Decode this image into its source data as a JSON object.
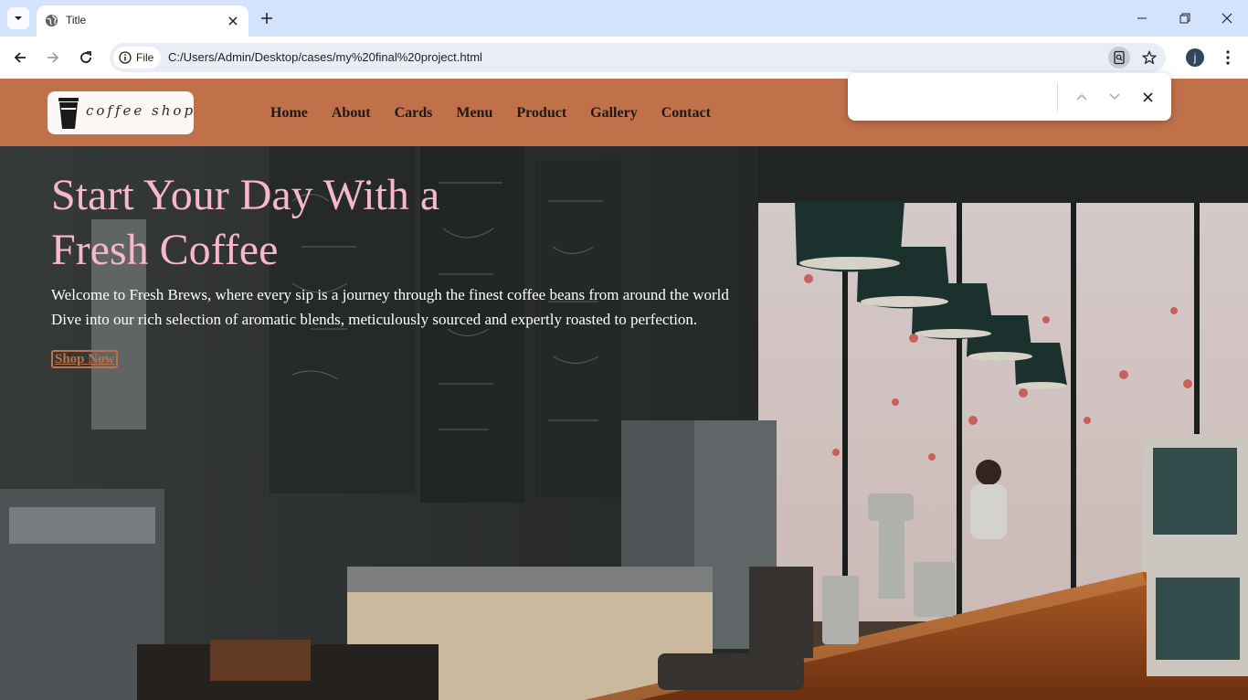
{
  "browser": {
    "tab_title": "Title",
    "address_chip": "File",
    "url": "C:/Users/Admin/Desktop/cases/my%20final%20project.html",
    "profile_initial": "j"
  },
  "site": {
    "logo_text": "coffee shop",
    "nav": [
      "Home",
      "About",
      "Cards",
      "Menu",
      "Product",
      "Gallery",
      "Contact"
    ],
    "accent_color": "#c0714a",
    "title_color": "#f6b7cf"
  },
  "hero": {
    "title": "Start Your Day With a Fresh Coffee",
    "line1": "Welcome to Fresh Brews, where every sip is a journey through the finest coffee beans from around the world",
    "line2": "Dive into our rich selection of aromatic blends, meticulously sourced and expertly roasted to perfection.",
    "cta": "Shop Now"
  },
  "find_bar": {
    "query": ""
  },
  "icons": {
    "tab_list": "chevron-down-icon",
    "favicon": "globe-icon",
    "close": "close-icon",
    "new_tab": "plus-icon",
    "back": "arrow-left-icon",
    "forward": "arrow-right-icon",
    "reload": "reload-icon",
    "info": "info-icon",
    "zoom": "search-page-icon",
    "bookmark": "star-icon",
    "menu": "more-vert-icon"
  }
}
